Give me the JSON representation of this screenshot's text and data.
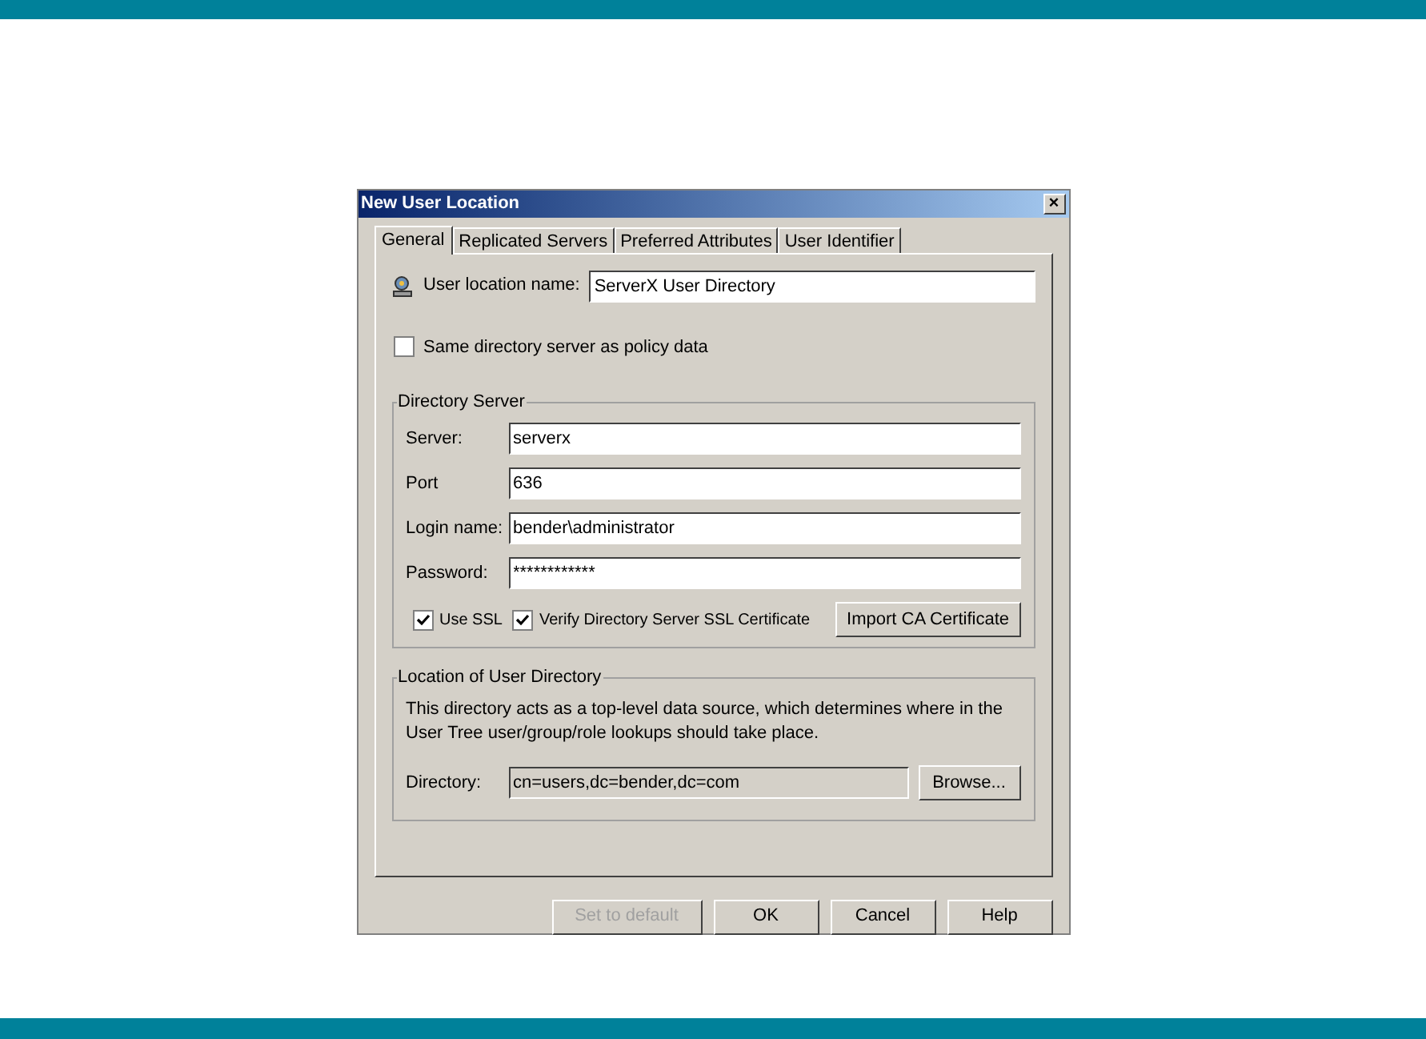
{
  "window": {
    "title": "New User Location",
    "close": "×"
  },
  "tabs": [
    {
      "label": "General",
      "selected": true
    },
    {
      "label": "Replicated Servers",
      "selected": false
    },
    {
      "label": "Preferred Attributes",
      "selected": false
    },
    {
      "label": "User Identifier",
      "selected": false
    }
  ],
  "location_name": {
    "label": "User location name:",
    "value": "ServerX User Directory"
  },
  "same_server": {
    "label": "Same directory server as policy data",
    "checked": false
  },
  "directory_server": {
    "title": "Directory Server",
    "fields": [
      {
        "label": "Server:",
        "value": "serverx"
      },
      {
        "label": "Port",
        "value": "636"
      },
      {
        "label": "Login name:",
        "value": "bender\\administrator"
      },
      {
        "label": "Password:",
        "value": "************"
      }
    ],
    "options": [
      {
        "label": "Use SSL",
        "checked": true
      },
      {
        "label": "Verify Directory Server SSL Certificate",
        "checked": true
      }
    ],
    "import_button": "Import CA Certificate"
  },
  "user_directory": {
    "title": "Location of User Directory",
    "description": "This directory acts as a top-level data source, which determines where in the User Tree user/group/role lookups should take place.",
    "label": "Directory:",
    "value": "cn=users,dc=bender,dc=com",
    "disabled": true,
    "browse_button": "Browse..."
  },
  "buttons": [
    {
      "label": "Set to default",
      "disabled": true
    },
    {
      "label": "OK",
      "disabled": false
    },
    {
      "label": "Cancel",
      "disabled": false
    },
    {
      "label": "Help",
      "disabled": false
    }
  ]
}
